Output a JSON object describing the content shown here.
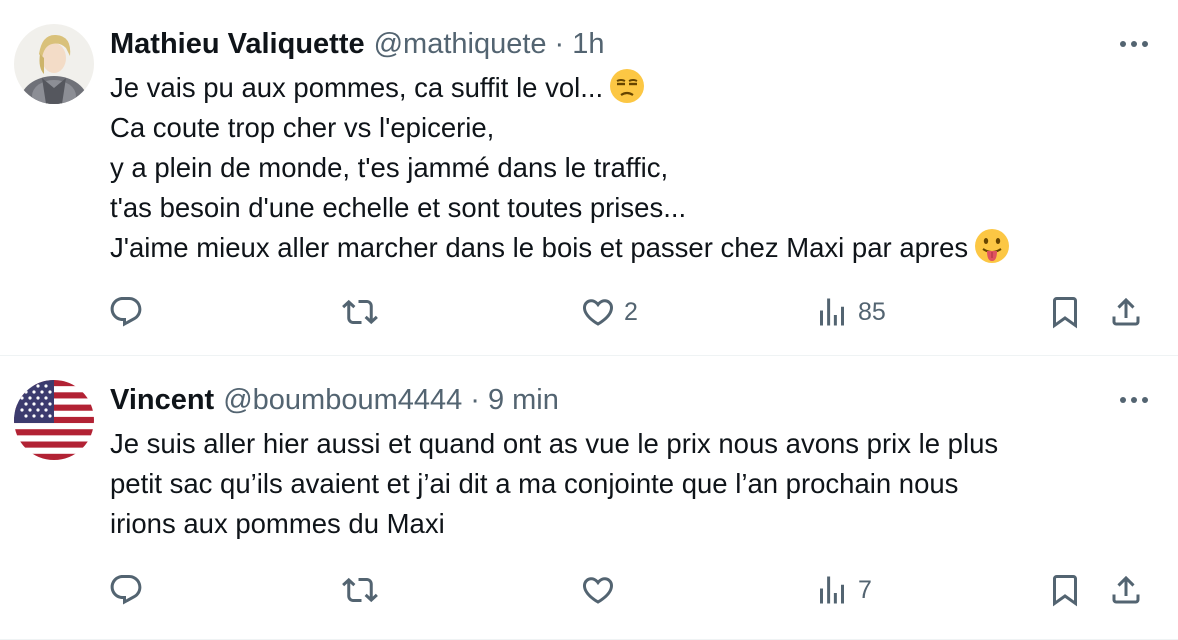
{
  "tweets": [
    {
      "name": "Mathieu Valiquette",
      "handle": "@mathiquete",
      "separator": "·",
      "time": "1h",
      "lines": [
        "Je vais pu aux pommes, ca suffit le vol...",
        "Ca coute trop cher vs l'epicerie,",
        "y a plein de monde, t'es jammé dans le traffic,",
        "t'as besoin d'une echelle et sont toutes prises...",
        "J'aime mieux aller marcher dans le bois et passer chez Maxi par apres"
      ],
      "emojis": [
        "unamused-face",
        "face-with-tongue"
      ],
      "likes": "2",
      "views": "85"
    },
    {
      "name": "Vincent",
      "handle": "@boumboum4444",
      "separator": "·",
      "time": "9 min",
      "lines": [
        "Je suis aller hier aussi et quand ont as vue le prix nous avons prix le plus",
        "petit sac qu’ils avaient et j’ai dit a ma conjointe que l’an prochain nous",
        "irions aux pommes du Maxi"
      ],
      "likes": "",
      "views": "7"
    }
  ],
  "icons": [
    "more-icon",
    "reply-icon",
    "retweet-icon",
    "like-icon",
    "views-icon",
    "bookmark-icon",
    "share-icon"
  ],
  "colors": {
    "text": "#0f1419",
    "secondary": "#536471",
    "divider": "#eff3f4"
  }
}
